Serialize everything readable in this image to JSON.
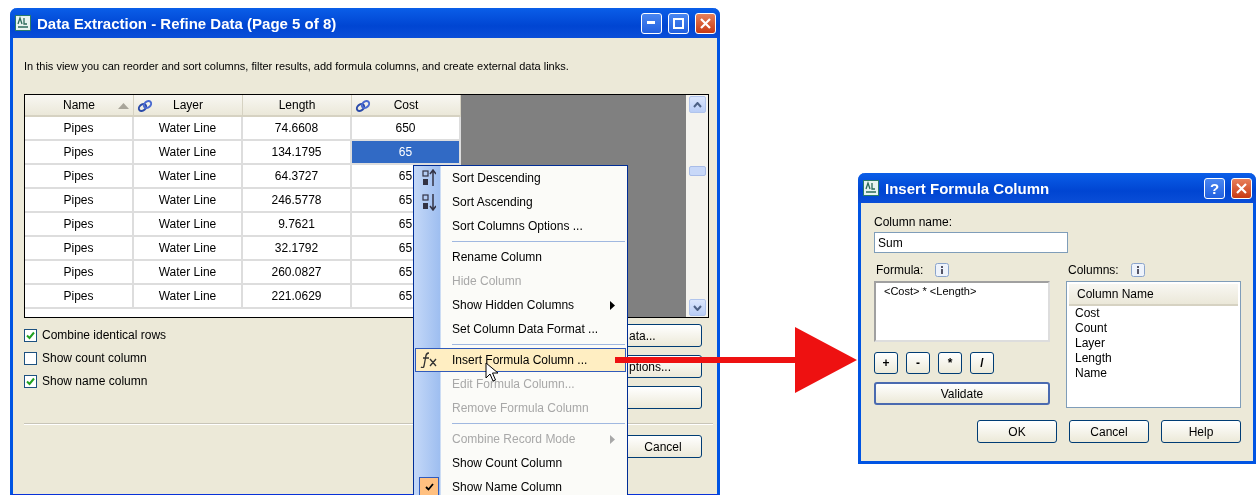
{
  "main_window": {
    "title": "Data Extraction - Refine Data (Page 5 of 8)",
    "description": "In this view you can reorder and sort columns, filter results, add formula columns, and create external data links.",
    "table": {
      "columns": [
        {
          "label": "Name",
          "sorted": true,
          "linked": false
        },
        {
          "label": "Layer",
          "sorted": false,
          "linked": true
        },
        {
          "label": "Length",
          "sorted": false,
          "linked": false
        },
        {
          "label": "Cost",
          "sorted": false,
          "linked": true
        }
      ],
      "rows": [
        {
          "cells": [
            "Pipes",
            "Water Line",
            "74.6608",
            "650"
          ],
          "selected": false
        },
        {
          "cells": [
            "Pipes",
            "Water Line",
            "134.1795",
            "65"
          ],
          "selected": true
        },
        {
          "cells": [
            "Pipes",
            "Water Line",
            "64.3727",
            "65"
          ],
          "selected": false
        },
        {
          "cells": [
            "Pipes",
            "Water Line",
            "246.5778",
            "65"
          ],
          "selected": false
        },
        {
          "cells": [
            "Pipes",
            "Water Line",
            "9.7621",
            "65"
          ],
          "selected": false
        },
        {
          "cells": [
            "Pipes",
            "Water Line",
            "32.1792",
            "65"
          ],
          "selected": false
        },
        {
          "cells": [
            "Pipes",
            "Water Line",
            "260.0827",
            "65"
          ],
          "selected": false
        },
        {
          "cells": [
            "Pipes",
            "Water Line",
            "221.0629",
            "65"
          ],
          "selected": false
        }
      ]
    },
    "options": [
      {
        "label": "Combine identical rows",
        "checked": true
      },
      {
        "label": "Show count column",
        "checked": false
      },
      {
        "label": "Show name column",
        "checked": true
      }
    ],
    "side_buttons": [
      "ata...",
      "ptions..."
    ],
    "cancel_button": "Cancel"
  },
  "context_menu": [
    {
      "kind": "sort-descending",
      "label": "Sort Descending",
      "disabled": false,
      "selected": false,
      "submenu": false,
      "checked": false
    },
    {
      "kind": "sort-ascending",
      "label": "Sort Ascending",
      "disabled": false,
      "selected": false,
      "submenu": false,
      "checked": false
    },
    {
      "kind": "item",
      "label": "Sort Columns Options ...",
      "disabled": false,
      "selected": false,
      "submenu": false,
      "checked": false
    },
    {
      "kind": "separator"
    },
    {
      "kind": "item",
      "label": "Rename Column",
      "disabled": false,
      "selected": false,
      "submenu": false,
      "checked": false
    },
    {
      "kind": "item",
      "label": "Hide Column",
      "disabled": true,
      "selected": false,
      "submenu": false,
      "checked": false
    },
    {
      "kind": "item",
      "label": "Show Hidden Columns",
      "disabled": false,
      "selected": false,
      "submenu": true,
      "checked": false
    },
    {
      "kind": "item",
      "label": "Set Column Data Format ...",
      "disabled": false,
      "selected": false,
      "submenu": false,
      "checked": false
    },
    {
      "kind": "separator"
    },
    {
      "kind": "formula",
      "label": "Insert Formula Column ...",
      "disabled": false,
      "selected": true,
      "submenu": false,
      "checked": false
    },
    {
      "kind": "item",
      "label": "Edit Formula Column...",
      "disabled": true,
      "selected": false,
      "submenu": false,
      "checked": false
    },
    {
      "kind": "item",
      "label": "Remove Formula Column",
      "disabled": true,
      "selected": false,
      "submenu": false,
      "checked": false
    },
    {
      "kind": "separator"
    },
    {
      "kind": "item",
      "label": "Combine Record Mode",
      "disabled": true,
      "selected": false,
      "submenu": true,
      "checked": false
    },
    {
      "kind": "item",
      "label": "Show Count Column",
      "disabled": false,
      "selected": false,
      "submenu": false,
      "checked": false
    },
    {
      "kind": "item",
      "label": "Show Name Column",
      "disabled": false,
      "selected": false,
      "submenu": false,
      "checked": true
    }
  ],
  "formula_dialog": {
    "title": "Insert Formula Column",
    "help_button": "?",
    "column_name_label": "Column name:",
    "column_name_value": "Sum",
    "formula_label": "Formula:",
    "formula_value": "<Cost> * <Length>",
    "operators": [
      "+",
      "-",
      "*",
      "/"
    ],
    "validate_button": "Validate",
    "columns_label": "Columns:",
    "columns_header": "Column Name",
    "columns": [
      "Cost",
      "Count",
      "Layer",
      "Length",
      "Name"
    ],
    "buttons": [
      "OK",
      "Cancel",
      "Help"
    ]
  }
}
